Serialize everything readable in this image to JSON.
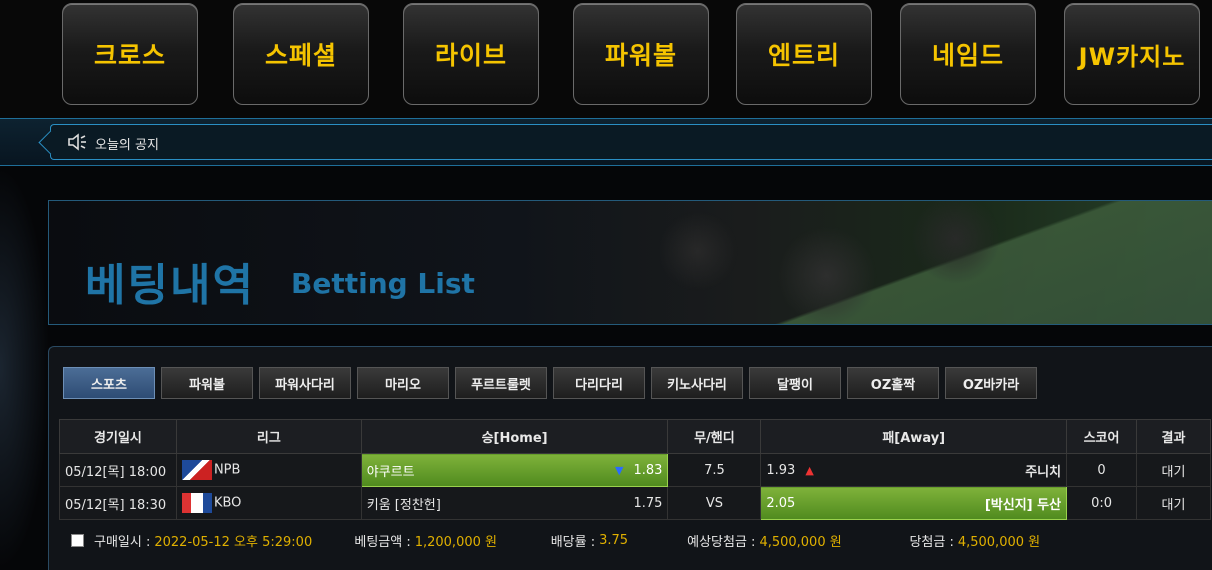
{
  "nav": [
    "크로스",
    "스페셜",
    "라이브",
    "파워볼",
    "엔트리",
    "네임드",
    "JW카지노"
  ],
  "notice": {
    "label": "오늘의 공지"
  },
  "banner": {
    "title": "베팅내역",
    "subtitle": "Betting List"
  },
  "tabs": [
    "스포츠",
    "파워볼",
    "파워사다리",
    "마리오",
    "푸르트룰렛",
    "다리다리",
    "키노사다리",
    "달팽이",
    "OZ홀짝",
    "OZ바카라"
  ],
  "table": {
    "headers": [
      "경기일시",
      "리그",
      "승[Home]",
      "무/핸디",
      "패[Away]",
      "스코어",
      "결과"
    ],
    "rows": [
      {
        "datetime": "05/12[목] 18:00",
        "league": "NPB",
        "home": "야쿠르트",
        "home_odds": "1.83",
        "draw": "7.5",
        "away_odds": "1.93",
        "away": "주니치",
        "score": "0",
        "result": "대기",
        "selected": "home"
      },
      {
        "datetime": "05/12[목] 18:30",
        "league": "KBO",
        "home": "키움 [정찬헌]",
        "home_odds": "1.75",
        "draw": "VS",
        "away_odds": "2.05",
        "away": "[박신지] 두산",
        "score": "0:0",
        "result": "대기",
        "selected": "away"
      }
    ]
  },
  "summary": {
    "purchase_label": "구매일시 :",
    "purchase_value": "2022-05-12 오후 5:29:00",
    "bet_label": "베팅금액 :",
    "bet_value": "1,200,000 원",
    "odds_label": "배당률 :",
    "odds_value": "3.75",
    "expected_label": "예상당첨금 :",
    "expected_value": "4,500,000 원",
    "win_label": "당첨금 :",
    "win_value": "4,500,000 원"
  },
  "colors": {
    "nav_text": "#f5c400",
    "accent_blue": "#1f74a6",
    "selected_green": "#6aa22d",
    "highlight": "#e0b000"
  }
}
